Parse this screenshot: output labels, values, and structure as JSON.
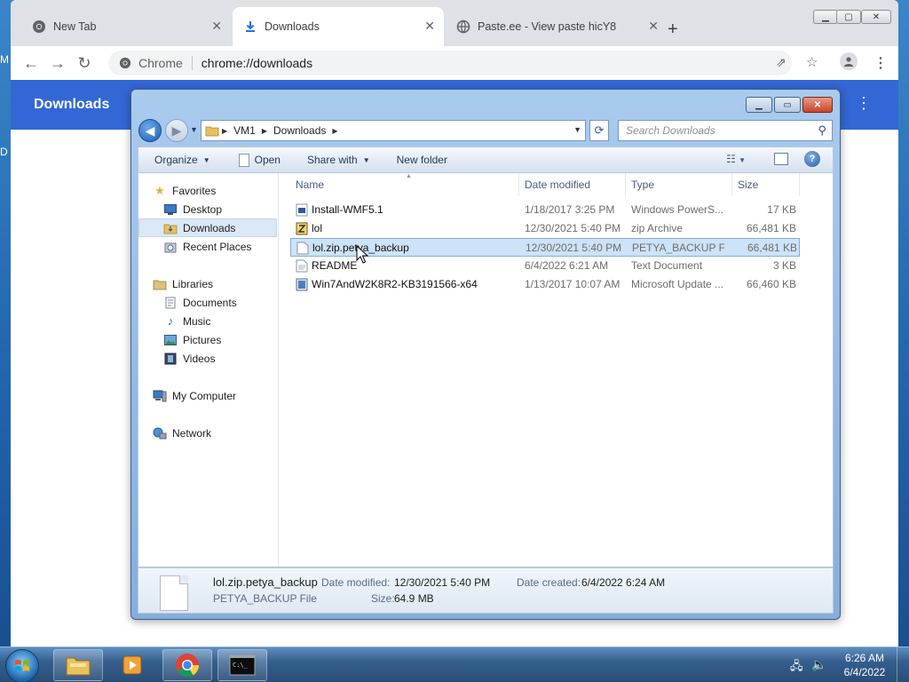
{
  "desktop": {
    "left_fragments": [
      "M",
      "D"
    ]
  },
  "chrome": {
    "tabs": [
      {
        "label": "New Tab",
        "icon": "chrome-icon"
      },
      {
        "label": "Downloads",
        "icon": "download-icon"
      },
      {
        "label": "Paste.ee - View paste hicY8",
        "icon": "globe-icon"
      }
    ],
    "omnibox": {
      "site_label": "Chrome",
      "url": "chrome://downloads"
    },
    "page_title": "Downloads"
  },
  "explorer": {
    "address": {
      "segments": [
        "VM1",
        "Downloads"
      ]
    },
    "search_placeholder": "Search Downloads",
    "commands": {
      "organize": "Organize",
      "open": "Open",
      "share_with": "Share with",
      "new_folder": "New folder"
    },
    "nav": {
      "favorites": "Favorites",
      "desktop": "Desktop",
      "downloads": "Downloads",
      "recent_places": "Recent Places",
      "libraries": "Libraries",
      "documents": "Documents",
      "music": "Music",
      "pictures": "Pictures",
      "videos": "Videos",
      "my_computer": "My Computer",
      "network": "Network"
    },
    "columns": {
      "name": "Name",
      "date_modified": "Date modified",
      "type": "Type",
      "size": "Size"
    },
    "files": [
      {
        "name": "Install-WMF5.1",
        "date": "1/18/2017 3:25 PM",
        "type": "Windows PowerS...",
        "size": "17 KB"
      },
      {
        "name": "lol",
        "date": "12/30/2021 5:40 PM",
        "type": "zip Archive",
        "size": "66,481 KB"
      },
      {
        "name": "lol.zip.petya_backup",
        "date": "12/30/2021 5:40 PM",
        "type": "PETYA_BACKUP File",
        "size": "66,481 KB"
      },
      {
        "name": "README",
        "date": "6/4/2022 6:21 AM",
        "type": "Text Document",
        "size": "3 KB"
      },
      {
        "name": "Win7AndW2K8R2-KB3191566-x64",
        "date": "1/13/2017 10:07 AM",
        "type": "Microsoft Update ...",
        "size": "66,460 KB"
      }
    ],
    "details": {
      "name": "lol.zip.petya_backup",
      "type": "PETYA_BACKUP File",
      "modified_label": "Date modified:",
      "modified_value": "12/30/2021 5:40 PM",
      "created_label": "Date created:",
      "created_value": "6/4/2022 6:24 AM",
      "size_label": "Size:",
      "size_value": "64.9 MB"
    }
  },
  "taskbar": {
    "time": "6:26 AM",
    "date": "6/4/2022"
  }
}
